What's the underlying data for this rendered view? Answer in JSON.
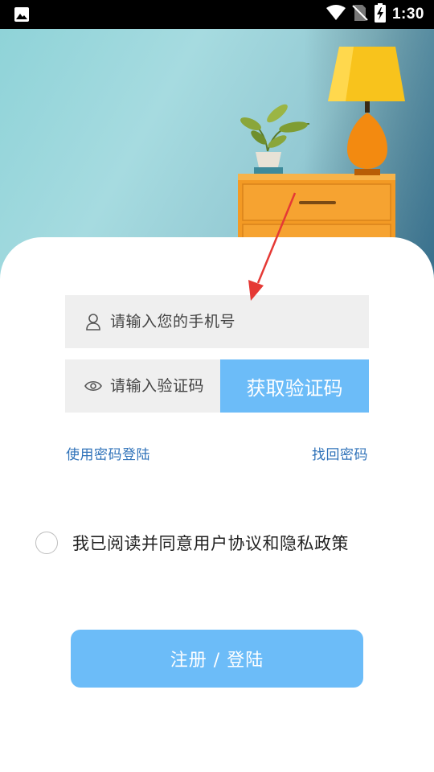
{
  "status_bar": {
    "time": "1:30",
    "icons": [
      "gallery-icon",
      "wifi-icon",
      "no-sim-icon",
      "battery-charging-icon"
    ]
  },
  "hero": {
    "image": "illustration of a teal room with an orange dresser, a potted plant and a yellow table lamp"
  },
  "login_form": {
    "phone_placeholder": "请输入您的手机号",
    "code_placeholder": "请输入验证码",
    "get_code_label": "获取验证码",
    "password_login_link": "使用密码登陆",
    "forgot_password_link": "找回密码",
    "agreement_text": "我已阅读并同意用户协议和隐私政策",
    "submit_label": "注册 / 登陆"
  },
  "colors": {
    "accent": "#6cbcf8",
    "link": "#2f72b9",
    "field_bg": "#efefef",
    "annotation_arrow": "#e53935"
  }
}
